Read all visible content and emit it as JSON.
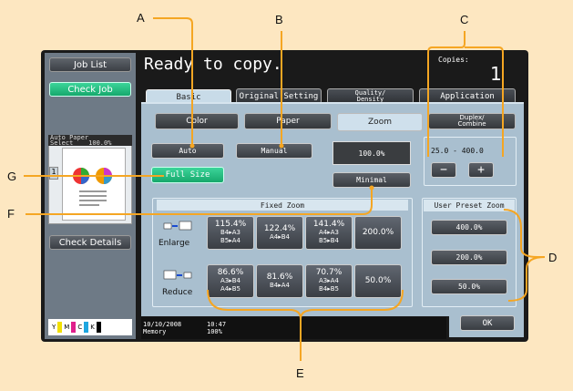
{
  "callouts": {
    "A": "A",
    "B": "B",
    "C": "C",
    "D": "D",
    "E": "E",
    "F": "F",
    "G": "G"
  },
  "left": {
    "job_list": "Job List",
    "check_job": "Check Job",
    "preview_header": "Auto Paper\nSelect    100.0%",
    "check_details": "Check Details",
    "ink": [
      "Y",
      "M",
      "C",
      "K"
    ]
  },
  "header": {
    "title": "Ready to copy.",
    "copies_label": "Copies:",
    "copies_value": "1"
  },
  "tabs": [
    "Basic",
    "Original Setting",
    "Quality/\nDensity",
    "Application"
  ],
  "subtabs": [
    "Color",
    "Paper",
    "Zoom",
    "Duplex/\nCombine"
  ],
  "zoom": {
    "auto": "Auto",
    "manual": "Manual",
    "full_size": "Full Size",
    "minimal": "Minimal",
    "current": "100.0%",
    "range": "25.0  -  400.0",
    "minus": "−",
    "plus": "+",
    "fixed_header": "Fixed Zoom",
    "enlarge": "Enlarge",
    "reduce": "Reduce",
    "enlarge_buttons": [
      {
        "pct": "115.4%",
        "sz": "B4▸A3\nB5▸A4"
      },
      {
        "pct": "122.4%",
        "sz": "A4▸B4"
      },
      {
        "pct": "141.4%",
        "sz": "A4▸A3\nB5▸B4"
      },
      {
        "pct": "200.0%",
        "sz": ""
      }
    ],
    "reduce_buttons": [
      {
        "pct": "86.6%",
        "sz": "A3▸B4\nA4▸B5"
      },
      {
        "pct": "81.6%",
        "sz": "B4▸A4"
      },
      {
        "pct": "70.7%",
        "sz": "A3▸A4\nB4▸B5"
      },
      {
        "pct": "50.0%",
        "sz": ""
      }
    ],
    "preset_header": "User Preset Zoom",
    "presets": [
      "400.0%",
      "200.0%",
      "50.0%"
    ],
    "ok": "OK"
  },
  "status": {
    "date": "10/10/2008",
    "time": "10:47",
    "memory_label": "Memory",
    "memory_value": "100%"
  },
  "colors": {
    "background": "#fde7c1",
    "callout_line": "#f5a623",
    "green": "#1fc07f",
    "panel": "#1a1a1a"
  }
}
